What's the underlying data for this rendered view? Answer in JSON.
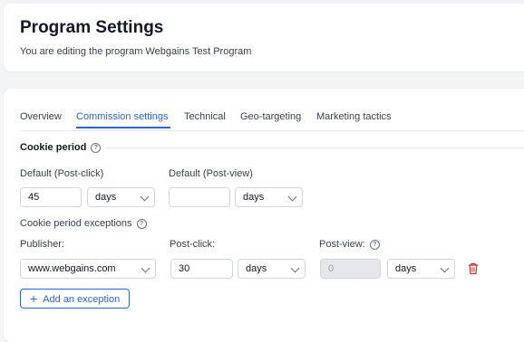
{
  "header": {
    "title": "Program Settings",
    "subtitle": "You are editing the program Webgains Test Program"
  },
  "tabs": [
    {
      "label": "Overview",
      "active": false
    },
    {
      "label": "Commission settings",
      "active": true
    },
    {
      "label": "Technical",
      "active": false
    },
    {
      "label": "Geo-targeting",
      "active": false
    },
    {
      "label": "Marketing tactics",
      "active": false
    }
  ],
  "cookie_period": {
    "title": "Cookie period",
    "default_post_click": {
      "label": "Default (Post-click)",
      "value": "45",
      "unit": "days"
    },
    "default_post_view": {
      "label": "Default (Post-view)",
      "value": "",
      "unit": "days"
    }
  },
  "exceptions": {
    "title": "Cookie period exceptions",
    "publisher_label": "Publisher:",
    "post_click_label": "Post-click:",
    "post_view_label": "Post-view:",
    "row": {
      "publisher": "www.webgains.com",
      "post_click_value": "30",
      "post_click_unit": "days",
      "post_view_value": "0",
      "post_view_unit": "days"
    },
    "add_label": "Add an exception"
  },
  "colors": {
    "accent": "#2563eb",
    "delete": "#dc2626",
    "background": "#f3f4f6"
  },
  "icons": {
    "info": "info-circle-icon",
    "dropdown": "chevron-down-icon",
    "delete": "trash-icon",
    "add": "plus-icon"
  }
}
